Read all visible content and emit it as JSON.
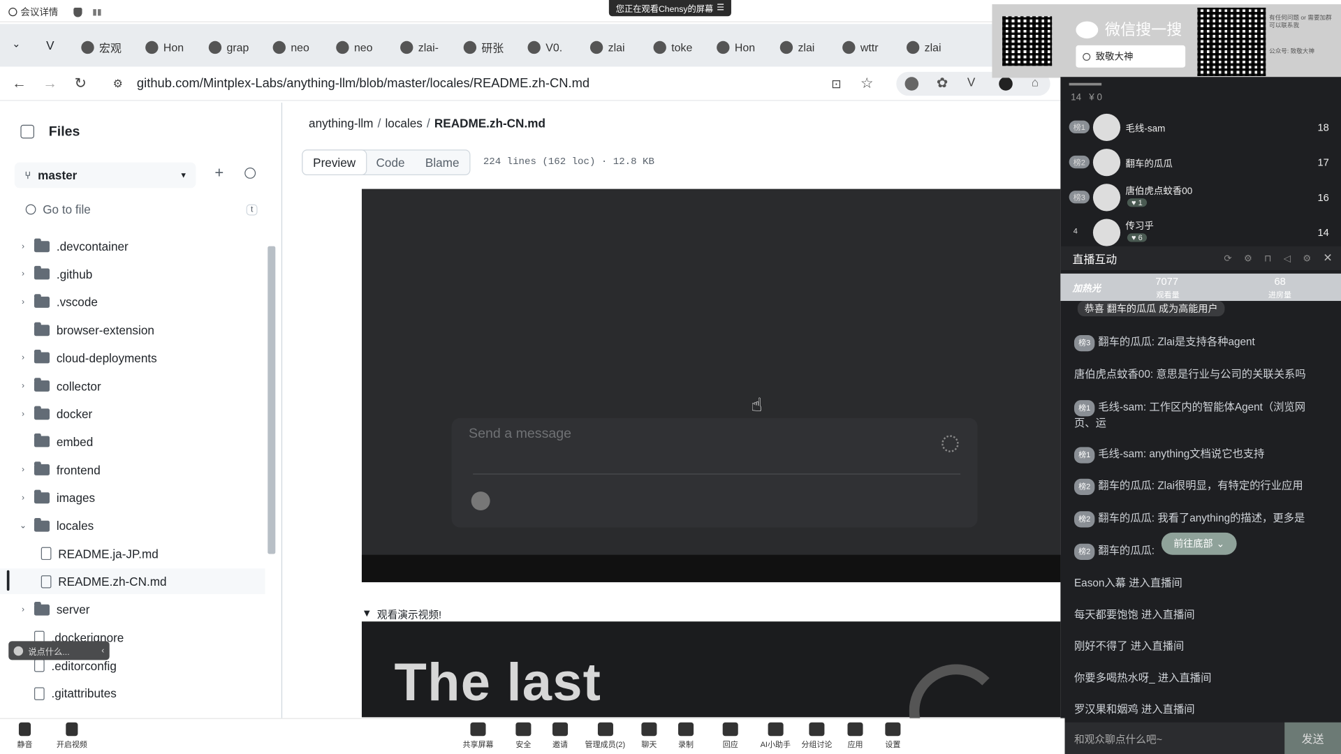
{
  "meeting": {
    "title": "会议详情",
    "share_banner": "您正在观看Chensy的屏幕"
  },
  "tabs": [
    "宏观",
    "Hon",
    "grap",
    "neo",
    "neo",
    "zlai-",
    "研张",
    "V0.",
    "zlai",
    "toke",
    "Hon",
    "zlai",
    "wttr",
    "zlai"
  ],
  "address": {
    "url": "github.com/Mintplex-Labs/anything-llm/blob/master/locales/README.zh-CN.md"
  },
  "sidebar": {
    "title": "Files",
    "branch": "master",
    "search_placeholder": "Go to file",
    "search_shortcut": "t",
    "items": [
      {
        "type": "folder",
        "label": ".devcontainer",
        "chev": "›"
      },
      {
        "type": "folder",
        "label": ".github",
        "chev": "›"
      },
      {
        "type": "folder",
        "label": ".vscode",
        "chev": "›"
      },
      {
        "type": "folder",
        "label": "browser-extension",
        "chev": ""
      },
      {
        "type": "folder",
        "label": "cloud-deployments",
        "chev": "›"
      },
      {
        "type": "folder",
        "label": "collector",
        "chev": "›"
      },
      {
        "type": "folder",
        "label": "docker",
        "chev": "›"
      },
      {
        "type": "folder",
        "label": "embed",
        "chev": ""
      },
      {
        "type": "folder",
        "label": "frontend",
        "chev": "›"
      },
      {
        "type": "folder",
        "label": "images",
        "chev": "›"
      },
      {
        "type": "folder",
        "label": "locales",
        "chev": "⌄"
      },
      {
        "type": "file",
        "label": "README.ja-JP.md",
        "chev": ""
      },
      {
        "type": "file",
        "label": "README.zh-CN.md",
        "chev": ""
      },
      {
        "type": "folder",
        "label": "server",
        "chev": "›"
      },
      {
        "type": "file",
        "label": ".dockerignore",
        "chev": ""
      },
      {
        "type": "file",
        "label": ".editorconfig",
        "chev": ""
      },
      {
        "type": "file",
        "label": ".gitattributes",
        "chev": ""
      }
    ],
    "chat_hint": "说点什么..."
  },
  "content": {
    "breadcrumb": {
      "repo": "anything-llm",
      "sep1": "/",
      "dir": "locales",
      "sep2": "/",
      "file": "README.zh-CN.md"
    },
    "tabs": {
      "preview": "Preview",
      "code": "Code",
      "blame": "Blame"
    },
    "fileinfo": "224 lines (162 loc) · 12.8 KB",
    "video_placeholder": "Send a message",
    "details_summary": "观看演示视频!",
    "video2_text": "The last"
  },
  "qr": {
    "title": "微信搜一搜",
    "search_text": "致敬大神",
    "note": "有任何问题 or 需要加群 可以联系我",
    "note2": "公众号: 致敬大神"
  },
  "rpanel": {
    "counts": "14   ¥ 0",
    "ranks": [
      {
        "badge": "榜1",
        "name": "毛线-sam",
        "score": "18",
        "likes": ""
      },
      {
        "badge": "榜2",
        "name": "翻车的瓜瓜",
        "score": "17",
        "likes": ""
      },
      {
        "badge": "榜3",
        "name": "唐伯虎点蚊香00",
        "score": "16",
        "likes": "1"
      },
      {
        "badge": "4",
        "name": "传习乎",
        "score": "14",
        "likes": "6"
      }
    ],
    "live_title": "直播互动",
    "stats": {
      "boost": "加热光",
      "views": "7077",
      "views_label": "观看量",
      "entries": "68",
      "entries_label": "进房量"
    },
    "congrats": "恭喜 翻车的瓜瓜 成为高能用户",
    "messages": [
      {
        "badge": "榜3",
        "text": "翻车的瓜瓜: Zlai是支持各种agent"
      },
      {
        "badge": "",
        "text": "唐伯虎点蚊香00: 意思是行业与公司的关联关系吗"
      },
      {
        "badge": "榜1",
        "text": "毛线-sam: 工作区内的智能体Agent（浏览网页、运"
      },
      {
        "badge": "榜1",
        "text": "毛线-sam: anything文档说它也支持"
      },
      {
        "badge": "榜2",
        "text": "翻车的瓜瓜: Zlai很明显，有特定的行业应用"
      },
      {
        "badge": "榜2",
        "text": "翻车的瓜瓜: 我看了anything的描述，更多是"
      },
      {
        "badge": "榜2",
        "text": "翻车的瓜瓜:"
      }
    ],
    "goto_bottom": "前往底部",
    "enters": [
      "Eason入幕 进入直播间",
      "每天都要饱饱 进入直播间",
      "刚好不得了 进入直播间",
      "你要多喝热水呀_ 进入直播间",
      "罗汉果和姻鸡 进入直播间"
    ],
    "input_placeholder": "和观众聊点什么吧~",
    "send": "发送"
  },
  "toolbar": {
    "left": [
      {
        "label": "静音"
      },
      {
        "label": "开启视频"
      }
    ],
    "center": [
      {
        "label": "共享屏幕"
      },
      {
        "label": "安全"
      },
      {
        "label": "邀请"
      },
      {
        "label": "管理成员(2)"
      },
      {
        "label": "聊天"
      },
      {
        "label": "录制"
      },
      {
        "label": "回应"
      },
      {
        "label": "AI小助手"
      },
      {
        "label": "分组讨论"
      },
      {
        "label": "应用"
      },
      {
        "label": "设置"
      }
    ]
  },
  "colors": {
    "accent": "#1f883d",
    "panel": "#1e1f22",
    "video": "#2a2b2d"
  }
}
